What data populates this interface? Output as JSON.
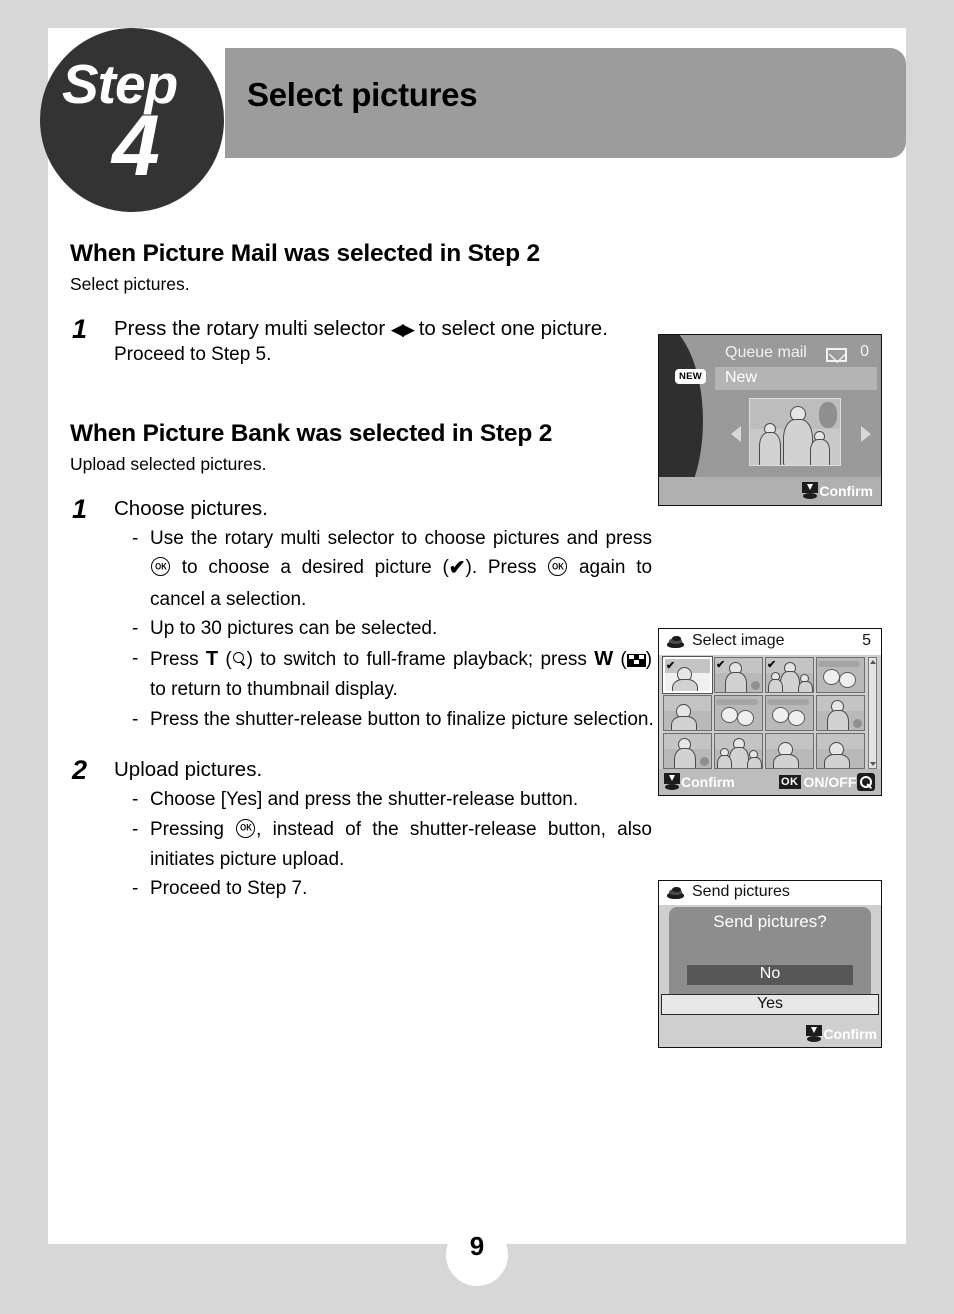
{
  "page": {
    "number": "9",
    "step_word": "Step",
    "step_number": "4",
    "title": "Select pictures"
  },
  "sections": [
    {
      "heading": "When Picture Mail was selected in Step 2",
      "subtitle": "Select pictures.",
      "steps": [
        {
          "marker": "1",
          "title_before": "Press the rotary multi selector",
          "title_after": "to select one picture.",
          "note": "Proceed to Step 5."
        }
      ]
    },
    {
      "heading": "When Picture Bank was selected in Step 2",
      "subtitle": "Upload selected pictures.",
      "steps": [
        {
          "marker": "1",
          "title": "Choose pictures.",
          "bullets": [
            {
              "p1": "Use the rotary multi selector to choose pictures and press",
              "p2": "to choose a desired picture (",
              "p3": "). Press",
              "p4": "again to cancel a selection."
            },
            {
              "p1": "Up to 30 pictures can be selected."
            },
            {
              "p1": "Press",
              "key_t": "T",
              "p2": "(",
              "p3": ") to switch to full-frame playback; press",
              "key_w": "W",
              "p4": "(",
              "p5": ") to return to thumbnail display."
            },
            {
              "p1": "Press the shutter-release button to finalize picture selection."
            }
          ]
        },
        {
          "marker": "2",
          "title": "Upload pictures.",
          "bullets": [
            {
              "p1": "Choose [Yes] and press the shutter-release button."
            },
            {
              "p1": "Pressing",
              "p2": ", instead of the shutter-release button, also initiates picture upload."
            },
            {
              "p1": "Proceed to Step 7."
            }
          ]
        }
      ]
    }
  ],
  "screens": {
    "queue_mail": {
      "title": "Queue mail",
      "mail_count": "0",
      "new_badge": "NEW",
      "new_label": "New",
      "footer_label": "Confirm",
      "envelope_icon": "envelope-icon",
      "left_arrow_icon": "left-arrow-icon",
      "right_arrow_icon": "right-arrow-icon"
    },
    "select_image": {
      "title": "Select image",
      "count": "5",
      "album_icon": "album-icon",
      "footer_confirm": "Confirm",
      "ok_badge": "OK",
      "footer_onoff": "ON/OFF",
      "magnifier_icon": "magnifier-icon",
      "thumbnails": [
        {
          "checked": true,
          "selected": true,
          "art": "portrait"
        },
        {
          "checked": true,
          "selected": false,
          "art": "person"
        },
        {
          "checked": true,
          "selected": false,
          "art": "family"
        },
        {
          "checked": false,
          "selected": false,
          "art": "flowers"
        },
        {
          "checked": false,
          "selected": false,
          "art": "portrait"
        },
        {
          "checked": false,
          "selected": false,
          "art": "flowers"
        },
        {
          "checked": false,
          "selected": false,
          "art": "flowers"
        },
        {
          "checked": false,
          "selected": false,
          "art": "person"
        },
        {
          "checked": false,
          "selected": false,
          "art": "person"
        },
        {
          "checked": false,
          "selected": false,
          "art": "family"
        },
        {
          "checked": false,
          "selected": false,
          "art": "portrait"
        },
        {
          "checked": false,
          "selected": false,
          "art": "portrait"
        }
      ]
    },
    "send_pictures": {
      "title": "Send pictures",
      "question": "Send pictures?",
      "option_no": "No",
      "option_yes": "Yes",
      "footer_label": "Confirm",
      "album_icon": "album-icon"
    }
  }
}
